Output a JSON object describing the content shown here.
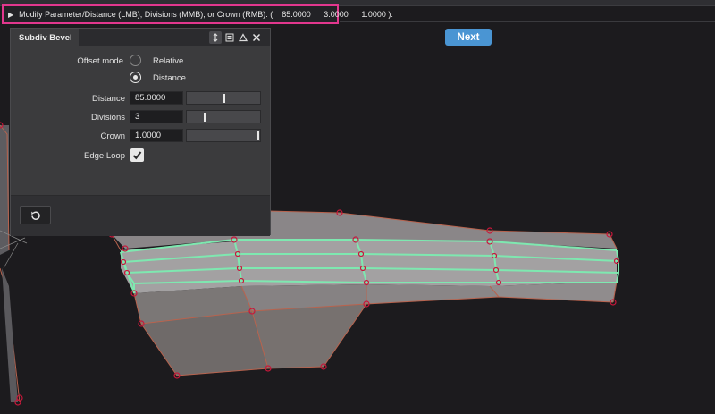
{
  "command_line": {
    "prompt": "Modify Parameter/Distance (LMB), Divisions (MMB), or Crown (RMB). (",
    "value_1": "85.0000",
    "value_2": "3.0000",
    "value_3": "1.0000 ):"
  },
  "next_button": {
    "label": "Next"
  },
  "panel": {
    "title": "Subdiv Bevel",
    "offset_mode": {
      "label": "Offset mode",
      "options": [
        "Relative",
        "Distance"
      ],
      "selected": "Distance"
    },
    "distance": {
      "label": "Distance",
      "value": "85.0000",
      "slider_fraction": 0.5
    },
    "divisions": {
      "label": "Divisions",
      "value": "3",
      "slider_fraction": 0.23
    },
    "crown": {
      "label": "Crown",
      "value": "1.0000",
      "slider_fraction": 0.97
    },
    "edge_loop": {
      "label": "Edge Loop",
      "checked": true
    }
  },
  "colors": {
    "highlight_border": "#e2378e",
    "next_button": "#4a95d3",
    "selected_edges": "#7ee8b0",
    "vertex_markers": "#c8173a",
    "mesh_edges": "#b8634e"
  },
  "icons": {
    "command_expand": "triangle-right-icon",
    "panel_pin": "pin-icon",
    "panel_menu": "menu-icon",
    "panel_collapse": "triangle-up-icon",
    "panel_close": "close-icon",
    "reset": "undo-icon"
  }
}
